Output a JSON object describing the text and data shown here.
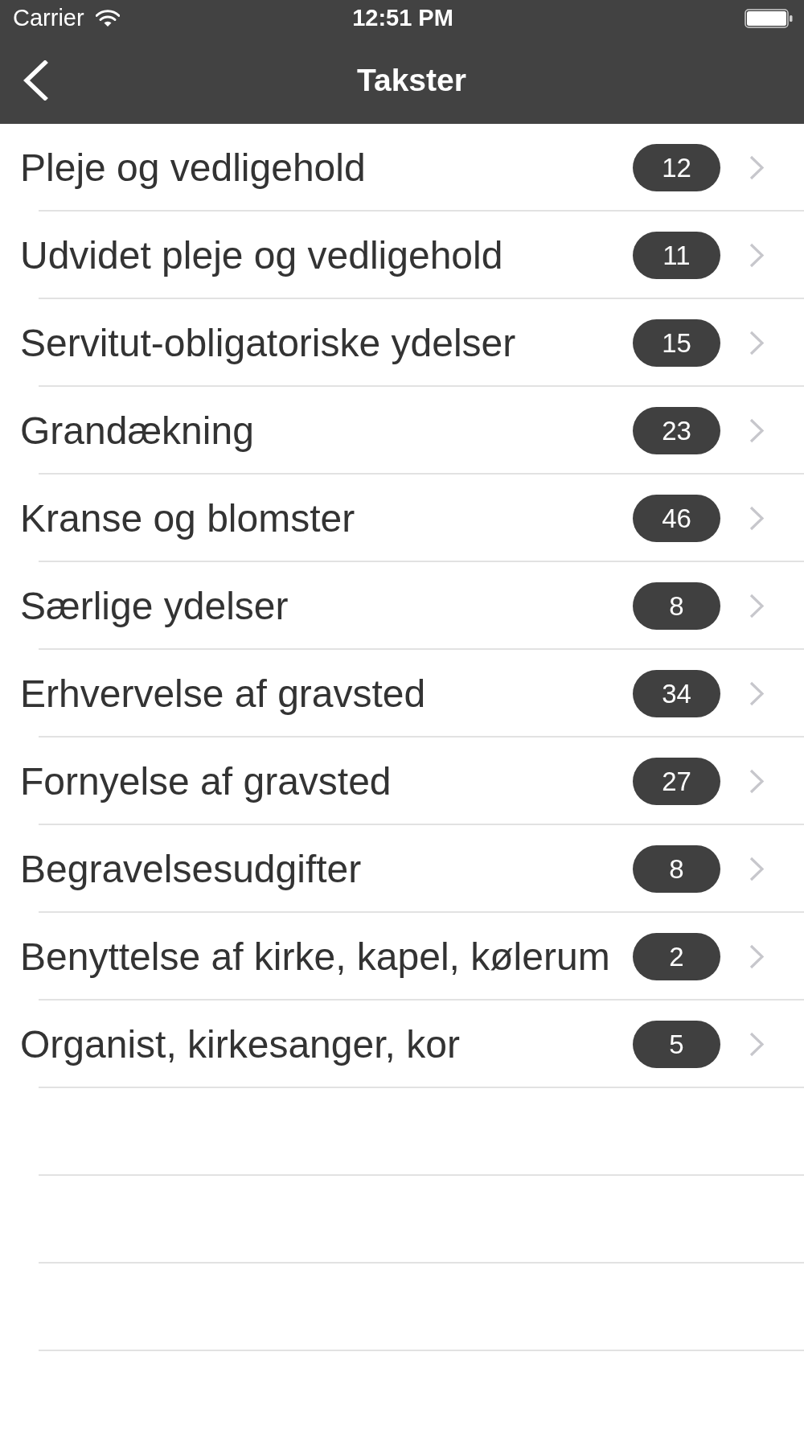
{
  "status_bar": {
    "carrier": "Carrier",
    "time": "12:51 PM"
  },
  "nav_bar": {
    "title": "Takster"
  },
  "list": {
    "items": [
      {
        "label": "Pleje og vedligehold",
        "count": "12"
      },
      {
        "label": "Udvidet pleje og vedligehold",
        "count": "11"
      },
      {
        "label": "Servitut-obligatoriske ydelser",
        "count": "15"
      },
      {
        "label": "Grandækning",
        "count": "23"
      },
      {
        "label": "Kranse og blomster",
        "count": "46"
      },
      {
        "label": "Særlige ydelser",
        "count": "8"
      },
      {
        "label": "Erhvervelse af gravsted",
        "count": "34"
      },
      {
        "label": "Fornyelse af gravsted",
        "count": "27"
      },
      {
        "label": "Begravelsesudgifter",
        "count": "8"
      },
      {
        "label": "Benyttelse af kirke, kapel, kølerum",
        "count": "2"
      },
      {
        "label": "Organist, kirkesanger, kor",
        "count": "5"
      }
    ]
  }
}
